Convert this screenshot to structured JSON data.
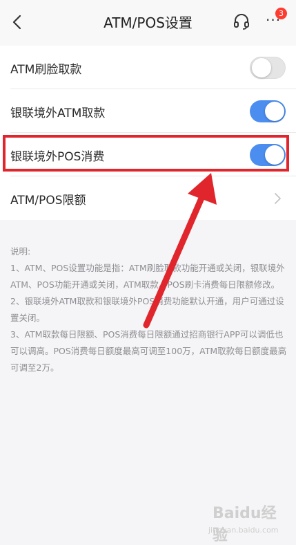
{
  "nav": {
    "title": "ATM/POS设置",
    "badge_count": "3",
    "icons": [
      "back-arrow-icon",
      "headset-icon",
      "more-icon"
    ]
  },
  "settings": [
    {
      "label": "ATM刷脸取款",
      "type": "toggle",
      "state": "off"
    },
    {
      "label": "银联境外ATM取款",
      "type": "toggle",
      "state": "on"
    },
    {
      "label": "银联境外POS消费",
      "type": "toggle",
      "state": "on"
    },
    {
      "label": "ATM/POS限额",
      "type": "link"
    }
  ],
  "notes": {
    "heading": "说明:",
    "lines": [
      "1、ATM、POS设置功能是指：ATM刷脸取款功能开通或关闭，银联境外ATM、POS功能开通或关闭，ATM取款、POS刷卡消费每日限额修改。",
      "2、银联境外ATM取款和银联境外POS消费功能默认开通，用户可通过设置关闭。",
      "3、ATM取款每日限额、POS消费每日限额通过招商银行APP可以调低也可以调高。POS消费每日额度最高可调至100万，ATM取款每日额度最高可调至2万。"
    ]
  },
  "watermark": {
    "main": "Baidu经验",
    "sub": "jingyan.baidu.com"
  },
  "colors": {
    "toggle_on": "#4b8ef0",
    "highlight": "#e0262c",
    "badge": "#ff3b30"
  }
}
